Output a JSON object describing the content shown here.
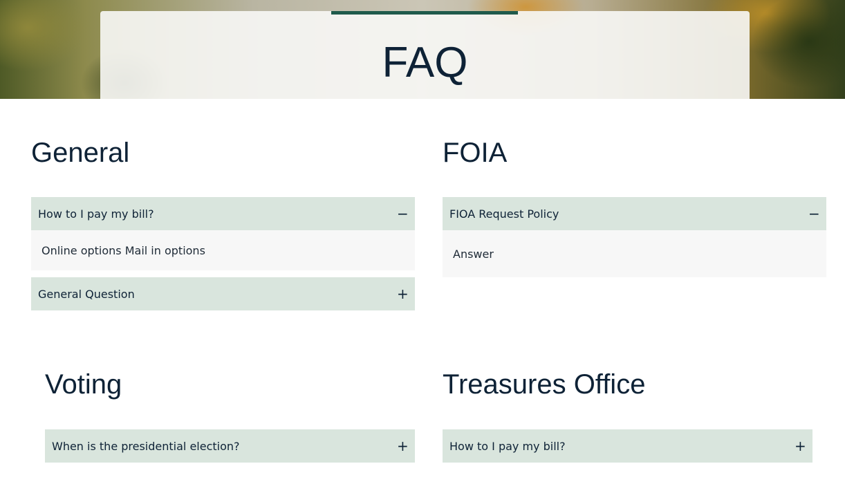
{
  "page": {
    "title": "FAQ"
  },
  "sections": [
    {
      "title": "General",
      "items": [
        {
          "question": "How to I pay my bill?",
          "toggle": "−",
          "answer": "Online options Mail in options",
          "expanded": true
        },
        {
          "question": "General Question",
          "toggle": "+",
          "expanded": false
        }
      ]
    },
    {
      "title": "FOIA",
      "items": [
        {
          "question": "FIOA Request Policy",
          "toggle": "−",
          "answer": "Answer",
          "expanded": true
        }
      ]
    },
    {
      "title": "Voting",
      "items": [
        {
          "question": "When is the presidential election?",
          "toggle": "+",
          "expanded": false
        }
      ]
    },
    {
      "title": "Treasures Office",
      "items": [
        {
          "question": "How to I pay my bill?",
          "toggle": "+",
          "expanded": false
        }
      ]
    }
  ],
  "colors": {
    "accent": "#1f5a4b",
    "heading": "#0e2236",
    "accordion_header": "#d9e5dd",
    "accordion_body": "#f7f7f7"
  }
}
